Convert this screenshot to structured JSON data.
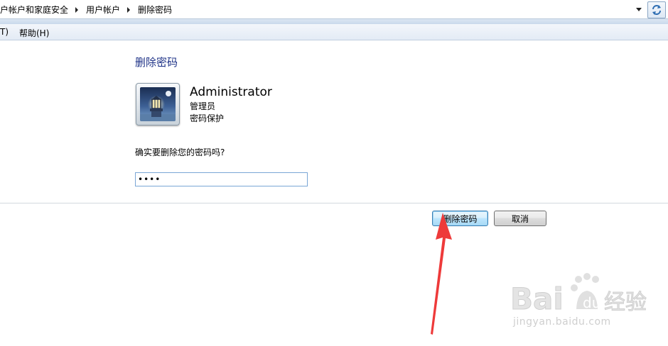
{
  "address_bar": {
    "breadcrumbs": [
      "户帐户和家庭安全",
      "用户帐户",
      "删除密码"
    ]
  },
  "menu": {
    "partial_item": "T)",
    "help": "帮助(H)"
  },
  "page": {
    "title": "删除密码",
    "user": {
      "name": "Administrator",
      "role": "管理员",
      "status": "密码保护"
    },
    "question": "确实要删除您的密码吗?",
    "password_value": "••••",
    "buttons": {
      "delete": "删除密码",
      "cancel": "取消"
    }
  },
  "watermark": {
    "logo_text": "Bai 经验",
    "url": "jingyan.baidu.com"
  },
  "colors": {
    "title_blue": "#1e3287",
    "annotation_arrow": "#ee3a3a"
  }
}
